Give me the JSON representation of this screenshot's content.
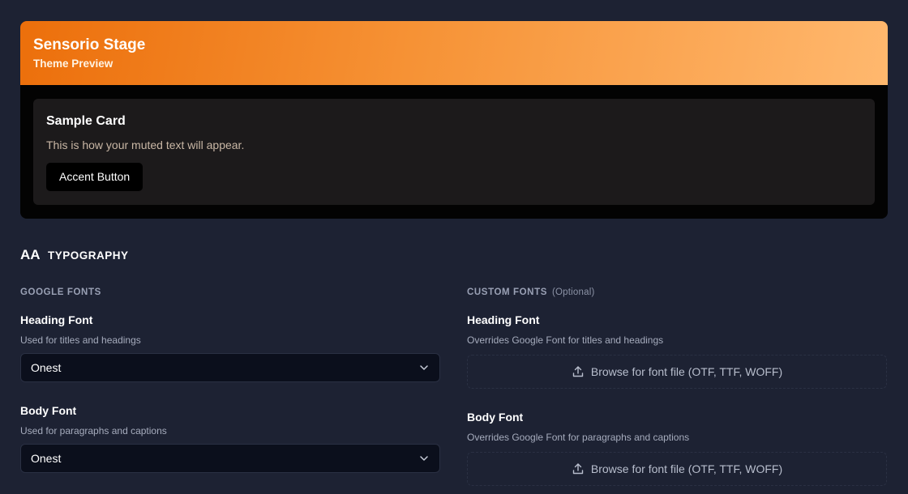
{
  "preview": {
    "brand_title": "Sensorio Stage",
    "brand_subtitle": "Theme Preview",
    "card_title": "Sample Card",
    "card_muted_text": "This is how your muted text will appear.",
    "accent_button_label": "Accent Button"
  },
  "typography": {
    "icon_text": "AA",
    "title": "TYPOGRAPHY",
    "google": {
      "label": "GOOGLE FONTS",
      "heading_title": "Heading Font",
      "heading_help": "Used for titles and headings",
      "heading_value": "Onest",
      "body_title": "Body Font",
      "body_help": "Used for paragraphs and captions",
      "body_value": "Onest"
    },
    "custom": {
      "label": "CUSTOM FONTS",
      "optional": "(Optional)",
      "heading_title": "Heading Font",
      "heading_help": "Overrides Google Font for titles and headings",
      "heading_upload": "Browse for font file (OTF, TTF, WOFF)",
      "body_title": "Body Font",
      "body_help": "Overrides Google Font for paragraphs and captions",
      "body_upload": "Browse for font file (OTF, TTF, WOFF)"
    }
  },
  "colors": {
    "accent_start": "#ec6f0b",
    "accent_end": "#ffb86e",
    "page_bg": "#1d2233"
  },
  "icons": {
    "typography": "aa-icon",
    "select": "chevron-down-icon",
    "upload": "upload-icon"
  }
}
